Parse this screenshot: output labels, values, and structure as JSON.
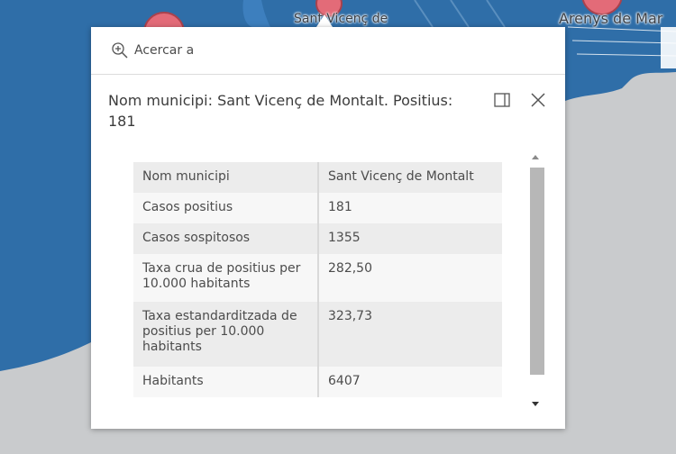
{
  "map": {
    "labels": {
      "sant_vicenc": "Sant Vicenç de",
      "arenys": "Arenys de Mar"
    },
    "colors": {
      "sea": "#2f6ea8",
      "land": "#c9cbcd",
      "marker": "#e36b78"
    }
  },
  "popup": {
    "zoom_label": "Acercar a",
    "title": "Nom municipi: Sant Vicenç de Montalt. Positius: 181",
    "table": [
      {
        "key": "Nom municipi",
        "value": "Sant Vicenç de Montalt"
      },
      {
        "key": "Casos positius",
        "value": "181"
      },
      {
        "key": "Casos sospitosos",
        "value": "1355"
      },
      {
        "key": "Taxa crua de positius per 10.000 habitants",
        "value": "282,50"
      },
      {
        "key": "Taxa estandarditzada de positius per 10.000 habitants",
        "value": "323,73"
      },
      {
        "key": "Habitants",
        "value": "6407"
      }
    ],
    "icons": {
      "zoom": "zoom-in-icon",
      "dock": "dock-icon",
      "close": "close-icon"
    }
  }
}
